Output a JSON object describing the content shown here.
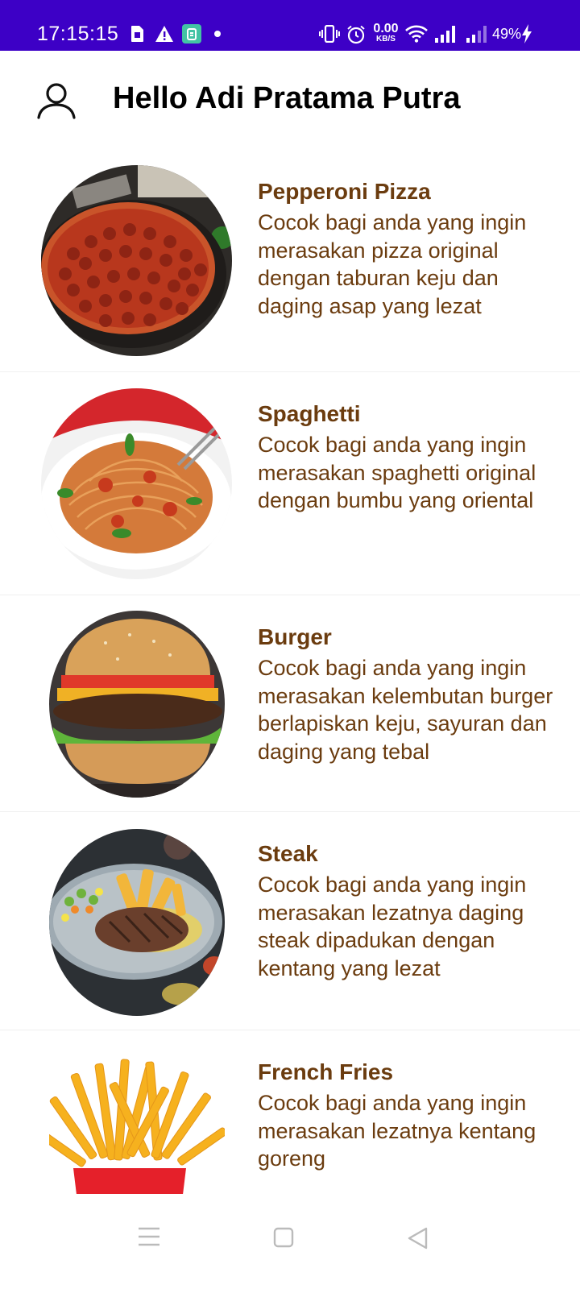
{
  "status_bar": {
    "time": "17:15:15",
    "speed_value": "0.00",
    "speed_unit": "KB/S",
    "battery": "49%",
    "icons": [
      "sim-card-icon",
      "warning-icon",
      "app-notification-icon",
      "dot-icon",
      "vibrate-icon",
      "alarm-icon",
      "wifi-icon",
      "signal-icon",
      "signal-weak-icon",
      "charging-icon"
    ],
    "background_color": "#3d00c6"
  },
  "header": {
    "greeting": "Hello Adi Pratama Putra",
    "icon": "user-icon"
  },
  "items": [
    {
      "title": "Pepperoni Pizza",
      "description": "Cocok bagi anda yang ingin merasakan pizza original dengan taburan keju dan daging asap yang lezat",
      "image": "pepperoni-pizza-image"
    },
    {
      "title": "Spaghetti",
      "description": "Cocok bagi anda yang ingin merasakan spaghetti original dengan bumbu yang oriental",
      "image": "spaghetti-image"
    },
    {
      "title": "Burger",
      "description": "Cocok bagi anda yang ingin merasakan kelembutan burger berlapiskan keju, sayuran dan daging yang tebal",
      "image": "burger-image"
    },
    {
      "title": "Steak",
      "description": "Cocok bagi anda yang ingin merasakan lezatnya daging steak dipadukan dengan kentang yang lezat",
      "image": "steak-image"
    },
    {
      "title": "French Fries",
      "description": "Cocok bagi anda yang ingin merasakan lezatnya kentang goreng",
      "image": "french-fries-image"
    }
  ],
  "text_color": "#6b3c0f",
  "nav_bar": {
    "icons": [
      "menu-icon",
      "home-icon",
      "back-icon"
    ]
  }
}
